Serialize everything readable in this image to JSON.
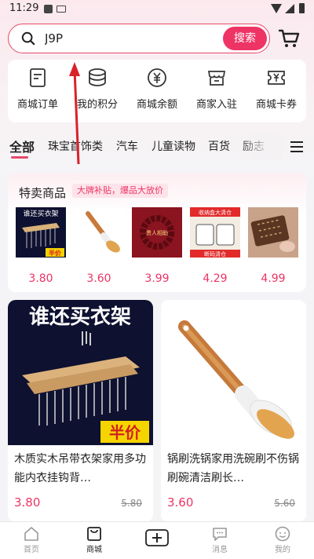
{
  "status_bar": {
    "time": "11:29"
  },
  "search": {
    "value": "J9P",
    "button_label": "搜索"
  },
  "quick_menu": [
    {
      "label": "商城订单",
      "icon": "order-icon"
    },
    {
      "label": "我的积分",
      "icon": "points-icon"
    },
    {
      "label": "商城余额",
      "icon": "balance-icon"
    },
    {
      "label": "商家入驻",
      "icon": "merchant-icon"
    },
    {
      "label": "商城卡券",
      "icon": "coupon-icon"
    }
  ],
  "tabs": [
    "全部",
    "珠宝首饰类",
    "汽车",
    "儿童读物",
    "百货",
    "励志"
  ],
  "special": {
    "title": "特卖商品",
    "badge": "大牌补贴，爆品大放价",
    "items": [
      {
        "price": "3.80",
        "thumb_text_top": "谁还买衣架",
        "thumb_text_bottom": "半价"
      },
      {
        "price": "3.60"
      },
      {
        "price": "3.99",
        "thumb_text": "贵人相助"
      },
      {
        "price": "4.29",
        "thumb_text_top": "收纳盒大清仓",
        "thumb_text_bottom": "断码清仓"
      },
      {
        "price": "4.99"
      }
    ]
  },
  "products": [
    {
      "title": "木质实木吊带衣架家用多功能内衣挂钩背…",
      "price": "3.80",
      "original_price": "5.80",
      "img_text_top": "谁还买衣架",
      "img_text_bottom": "半价"
    },
    {
      "title": "锅刷洗锅家用洗碗刷不伤锅刷碗清洁刷长…",
      "price": "3.60",
      "original_price": "5.60"
    }
  ],
  "bottom_nav": [
    {
      "label": "首页",
      "icon": "home-icon"
    },
    {
      "label": "商城",
      "icon": "mall-icon",
      "active": true
    },
    {
      "label": "",
      "icon": "add-icon"
    },
    {
      "label": "消息",
      "icon": "message-icon"
    },
    {
      "label": "我的",
      "icon": "profile-icon"
    }
  ],
  "colors": {
    "accent": "#ee3465",
    "annotation_arrow": "#d9222a"
  }
}
